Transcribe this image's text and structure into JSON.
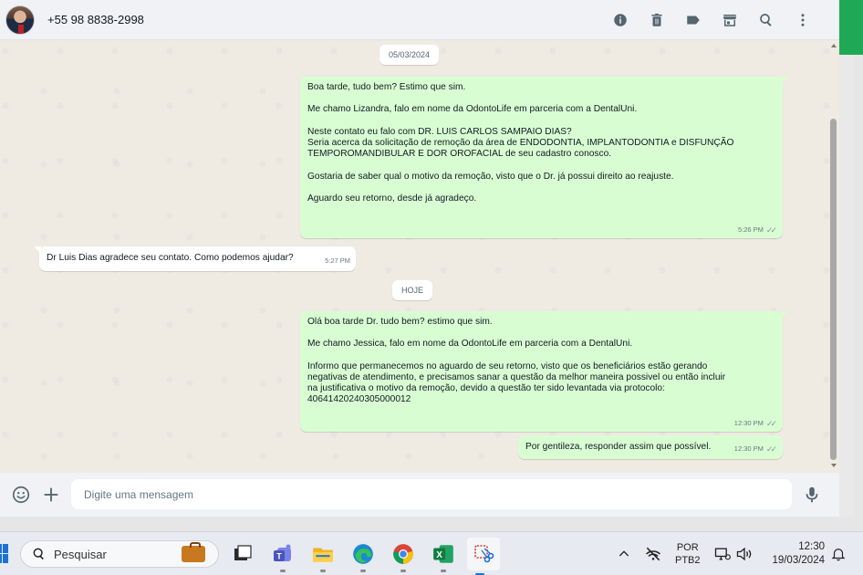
{
  "header": {
    "contact_number": "+55 98 8838-2998",
    "icons": [
      "info-icon",
      "trash-icon",
      "label-icon",
      "store-icon",
      "search-icon",
      "menu-dots-icon"
    ]
  },
  "chat": {
    "date_chips": [
      "05/03/2024",
      "HOJE"
    ],
    "messages": [
      {
        "direction": "out",
        "text": "Boa tarde, tudo bem? Estimo que sim.\n\nMe chamo Lizandra, falo em nome da OdontoLife em parceria com a DentalUni.\n\nNeste contato eu falo com DR. LUIS CARLOS SAMPAIO DIAS?\nSeria acerca da solicitação de remoção da área de ENDODONTIA, IMPLANTODONTIA e DISFUNÇÃO\nTEMPOROMANDIBULAR E DOR OROFACIAL de seu cadastro conosco.\n\nGostaria de saber qual o motivo da remoção, visto que o Dr. já possui direito ao reajuste.\n\nAguardo seu retorno, desde já agradeço.",
        "time": "5:26 PM",
        "ticks": "✓✓"
      },
      {
        "direction": "in",
        "text": "Dr Luis Dias agradece seu contato. Como podemos ajudar?",
        "time": "5:27 PM"
      },
      {
        "direction": "out",
        "text": "Olá boa tarde Dr. tudo bem? estimo que sim.\n\nMe chamo Jessica, falo em nome da OdontoLife em parceria com a DentalUni.\n\nInformo que permanecemos no aguardo de seu retorno, visto que os beneficiários estão gerando\nnegativas de atendimento, e precisamos sanar a questão da melhor maneira possivel ou então incluir\nna justificativa o motivo da remoção, devido a questão ter sido levantada via protocolo:\n40641420240305000012",
        "time": "12:30 PM",
        "ticks": "✓✓"
      },
      {
        "direction": "out",
        "text": "Por gentileza, responder assim que possível.",
        "time": "12:30 PM",
        "ticks": "✓✓"
      }
    ]
  },
  "composer": {
    "placeholder": "Digite uma mensagem"
  },
  "taskbar": {
    "search_label": "Pesquisar",
    "language": "POR",
    "layout": "PTB2",
    "time": "12:30",
    "date": "19/03/2024"
  }
}
